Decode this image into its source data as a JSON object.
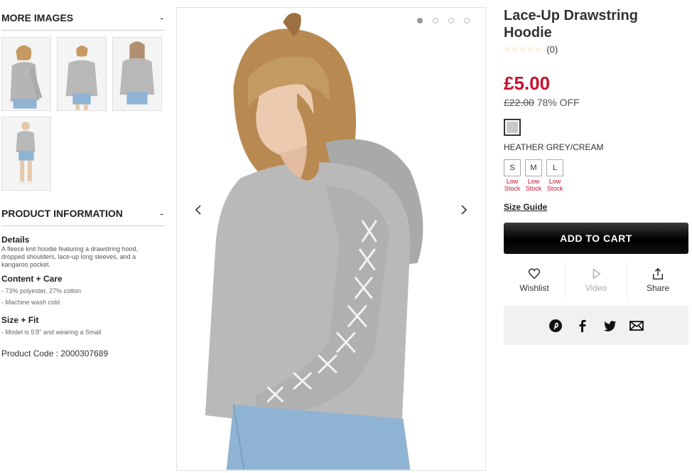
{
  "more_images": {
    "heading": "MORE IMAGES",
    "toggle": "-"
  },
  "product_information": {
    "heading": "PRODUCT INFORMATION",
    "toggle": "-",
    "details_title": "Details",
    "details_text": "A fleece knit hoodie featuring a drawstring hood, dropped shoulders, lace-up long sleeves, and a kangaroo pocket.",
    "content_care_title": "Content + Care",
    "content_care_lines": [
      "- 73% polyester, 27% cotton",
      "- Machine wash cold"
    ],
    "size_fit_title": "Size + Fit",
    "size_fit_lines": [
      "- Model is 5'8\" and wearing a Small"
    ],
    "product_code": "Product Code : 2000307689"
  },
  "product": {
    "title": "Lace-Up Drawstring Hoodie",
    "stars": "☆☆☆☆☆",
    "review_count": "(0)",
    "price": "£5.00",
    "old_price": "£22.00",
    "discount": "78% OFF",
    "color_name": "HEATHER GREY/CREAM",
    "swatch_color": "#c8c8c8",
    "sizes": [
      {
        "label": "S",
        "stock": [
          "Low",
          "Stock"
        ]
      },
      {
        "label": "M",
        "stock": [
          "Low",
          "Stock"
        ]
      },
      {
        "label": "L",
        "stock": [
          "Low",
          "Stock"
        ]
      }
    ],
    "size_guide": "Size Guide",
    "add_to_cart": "ADD TO CART",
    "actions": {
      "wishlist": "Wishlist",
      "video": "Video",
      "share": "Share"
    }
  },
  "colors": {
    "price_red": "#c8102e",
    "sweater_grey": "#b9b9b9",
    "denim": "#8fb3d3"
  },
  "carousel": {
    "slide_count": 4,
    "active_index": 0
  }
}
